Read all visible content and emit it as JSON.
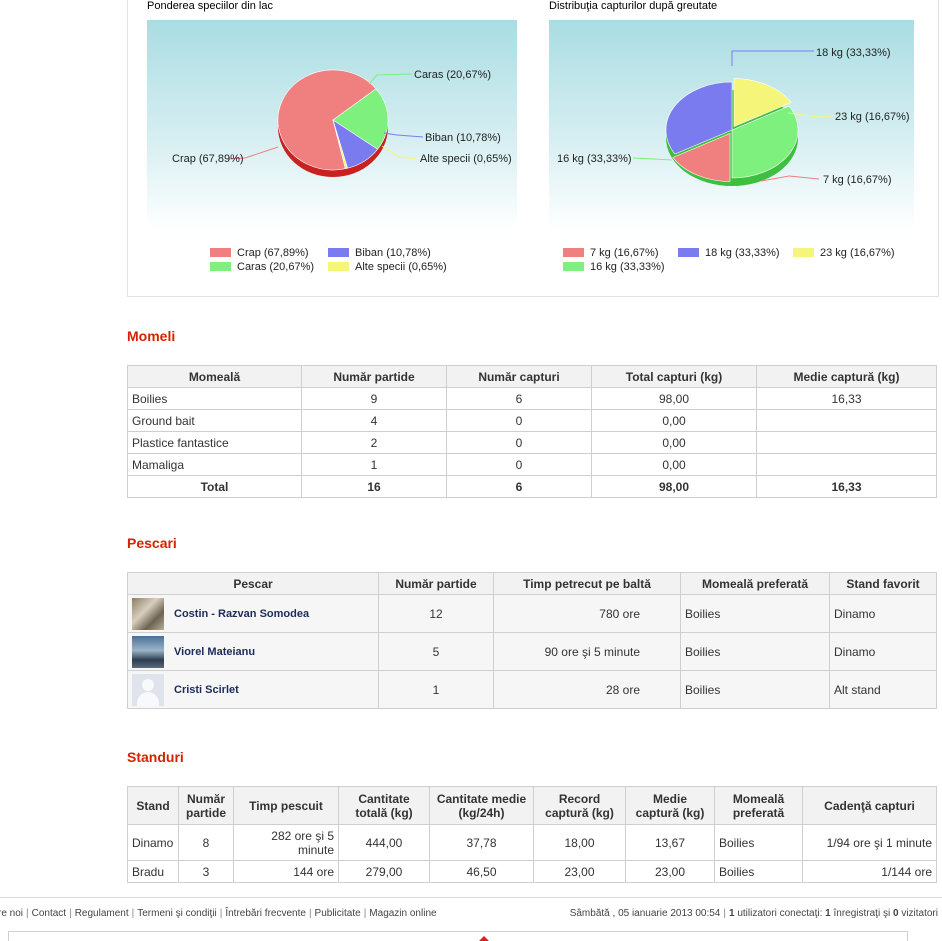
{
  "pie1": {
    "title": "Ponderea speciilor din lac",
    "labels": [
      "Crap (67,89%)",
      "Caras (20,67%)",
      "Biban (10,78%)",
      "Alte specii (0,65%)"
    ],
    "legend": [
      "Crap (67,89%)",
      "Biban (10,78%)",
      "Caras (20,67%)",
      "Alte specii (0,65%)"
    ],
    "colors": {
      "crap": "#f07f7f",
      "caras": "#7df07d",
      "biban": "#7b7bf0",
      "alte": "#f5f57a"
    }
  },
  "pie2": {
    "title": "Distribuţia capturilor după greutate",
    "labels": [
      "18 kg (33,33%)",
      "23 kg (16,67%)",
      "7 kg (16,67%)",
      "16 kg (33,33%)"
    ],
    "legend": [
      "7 kg (16,67%)",
      "18 kg (33,33%)",
      "23 kg (16,67%)",
      "16 kg (33,33%)"
    ]
  },
  "chart_data": [
    {
      "type": "pie",
      "title": "Ponderea speciilor din lac",
      "categories": [
        "Crap",
        "Caras",
        "Biban",
        "Alte specii"
      ],
      "values": [
        67.89,
        20.67,
        10.78,
        0.65
      ],
      "legend_position": "bottom"
    },
    {
      "type": "pie",
      "title": "Distribuţia capturilor după greutate",
      "categories": [
        "7 kg",
        "18 kg",
        "23 kg",
        "16 kg"
      ],
      "values": [
        16.67,
        33.33,
        16.67,
        33.33
      ],
      "legend_position": "bottom"
    }
  ],
  "momeli": {
    "heading": "Momeli",
    "headers": [
      "Momeală",
      "Număr partide",
      "Număr capturi",
      "Total capturi (kg)",
      "Medie captură (kg)"
    ],
    "rows": [
      [
        "Boilies",
        "9",
        "6",
        "98,00",
        "16,33"
      ],
      [
        "Ground bait",
        "4",
        "0",
        "0,00",
        ""
      ],
      [
        "Plastice fantastice",
        "2",
        "0",
        "0,00",
        ""
      ],
      [
        "Mamaliga",
        "1",
        "0",
        "0,00",
        ""
      ]
    ],
    "total": [
      "Total",
      "16",
      "6",
      "98,00",
      "16,33"
    ]
  },
  "pescari": {
    "heading": "Pescari",
    "headers": [
      "Pescar",
      "Număr partide",
      "Timp petrecut pe baltă",
      "Momeală preferată",
      "Stand favorit"
    ],
    "rows": [
      [
        "Costin - Razvan Somodea",
        "12",
        "780 ore",
        "Boilies",
        "Dinamo"
      ],
      [
        "Viorel Mateianu",
        "5",
        "90 ore şi 5 minute",
        "Boilies",
        "Dinamo"
      ],
      [
        "Cristi Scirlet",
        "1",
        "28 ore",
        "Boilies",
        "Alt stand"
      ]
    ]
  },
  "standuri": {
    "heading": "Standuri",
    "headers": [
      "Stand",
      "Număr partide",
      "Timp pescuit",
      "Cantitate totală (kg)",
      "Cantitate medie (kg/24h)",
      "Record captură (kg)",
      "Medie captură (kg)",
      "Momeală preferată",
      "Cadenţă capturi"
    ],
    "rows": [
      [
        "Dinamo",
        "8",
        "282 ore şi 5 minute",
        "444,00",
        "37,78",
        "18,00",
        "13,67",
        "Boilies",
        "1/94 ore şi 1 minute"
      ],
      [
        "Bradu",
        "3",
        "144 ore",
        "279,00",
        "46,50",
        "23,00",
        "23,00",
        "Boilies",
        "1/144 ore"
      ]
    ]
  },
  "footer": {
    "links": [
      "re noi",
      "Contact",
      "Regulament",
      "Termeni şi condiţii",
      "Întrebări frecvente",
      "Publicitate",
      "Magazin online"
    ],
    "date": "Sâmbătă , 05 ianuarie 2013 00:54",
    "users_count": "1",
    "users_text": "utilizatori conectaţi:",
    "reg_count": "1",
    "reg_text": "înregistraţi şi",
    "vis_count": "0",
    "vis_text": "vizitatori"
  }
}
